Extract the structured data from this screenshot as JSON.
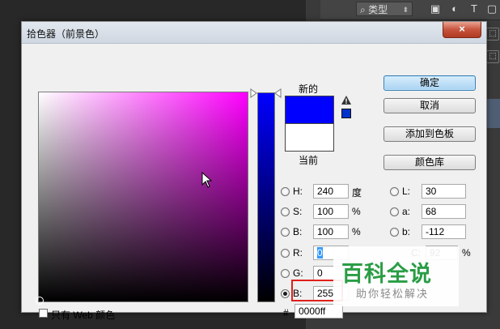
{
  "toolbar": {
    "search_label": "类型",
    "filter_text_icon": "T"
  },
  "dialog": {
    "title": "拾色器（前景色）",
    "close_glyph": "×",
    "new_label": "新的",
    "current_label": "当前",
    "buttons": {
      "ok": "确定",
      "cancel": "取消",
      "add_to_swatches": "添加到色板",
      "color_libraries": "颜色库"
    },
    "hsb": {
      "h_label": "H:",
      "h_value": "240",
      "h_unit": "度",
      "s_label": "S:",
      "s_value": "100",
      "s_unit": "%",
      "b_label": "B:",
      "b_value": "100",
      "b_unit": "%"
    },
    "rgb": {
      "r_label": "R:",
      "r_value": "0",
      "g_label": "G:",
      "g_value": "0",
      "b_label": "B:",
      "b_value": "255"
    },
    "lab": {
      "l_label": "L:",
      "l_value": "30",
      "a_label": "a:",
      "a_value": "68",
      "b_label": "b:",
      "b_value": "-112"
    },
    "cmyk": {
      "c_label": "C:",
      "c_value": "92",
      "c_unit": "%"
    },
    "hex": {
      "prefix": "#",
      "value": "0000ff"
    },
    "web_only_label": "只有 Web 颜色",
    "selected_radio": "B (RGB)",
    "colors": {
      "new": "#0000ff",
      "current": "#ffffff",
      "highlight_box": "#e0201a"
    }
  },
  "watermark": {
    "title": "百科全说",
    "subtitle": "助你轻松解决"
  }
}
